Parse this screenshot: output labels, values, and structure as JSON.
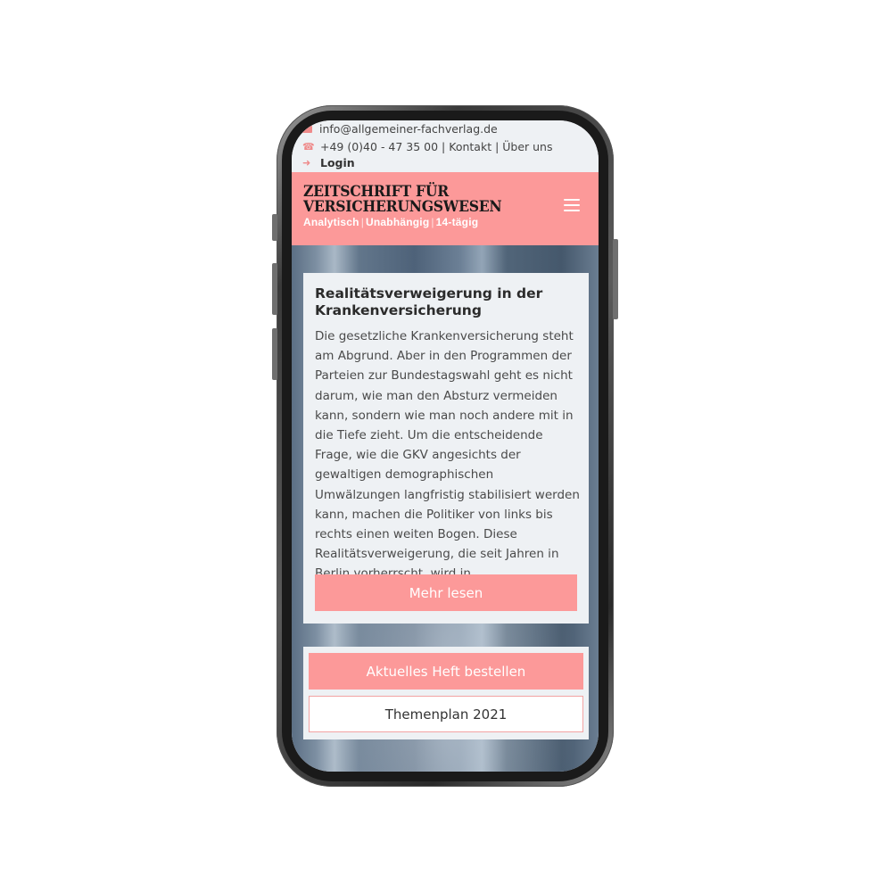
{
  "topbar": {
    "email": "info@allgemeiner-fachverlag.de",
    "contact_line": "+49 (0)40 - 47 35 00 | Kontakt | Über uns",
    "login": "Login"
  },
  "header": {
    "logo_line1": "ZEITSCHRIFT FÜR",
    "logo_line2": "VERSICHERUNGSWESEN",
    "tag1": "Analytisch",
    "tag2": "Unabhängig",
    "tag3": "14-tägig",
    "tag_separator": "|"
  },
  "article": {
    "title": "Realitätsverweigerung in der Krankenversicherung",
    "excerpt": "Die gesetzliche Krankenversicherung steht am Abgrund. Aber in den Programmen der Parteien zur Bundestagswahl geht es nicht darum, wie man den Absturz vermeiden kann, sondern wie man noch andere mit in die Tiefe zieht. Um die entscheidende Frage, wie die GKV angesichts der gewaltigen demographischen Umwälzungen langfristig stabilisiert werden kann, machen die Politiker von links bis rechts einen weiten Bogen. Diese Realitätsverweigerung, die seit Jahren in Berlin vorherrscht, wird in...",
    "more_label": "Mehr lesen"
  },
  "actions": {
    "order_label": "Aktuelles Heft bestellen",
    "plan_label": "Themenplan 2021"
  },
  "colors": {
    "accent": "#fc9999",
    "topbar_bg": "#eef1f4",
    "text_dark": "#2b2b2b"
  },
  "icons": {
    "email": "envelope-icon",
    "phone": "phone-icon",
    "login": "sign-in-icon",
    "menu": "hamburger-icon"
  }
}
